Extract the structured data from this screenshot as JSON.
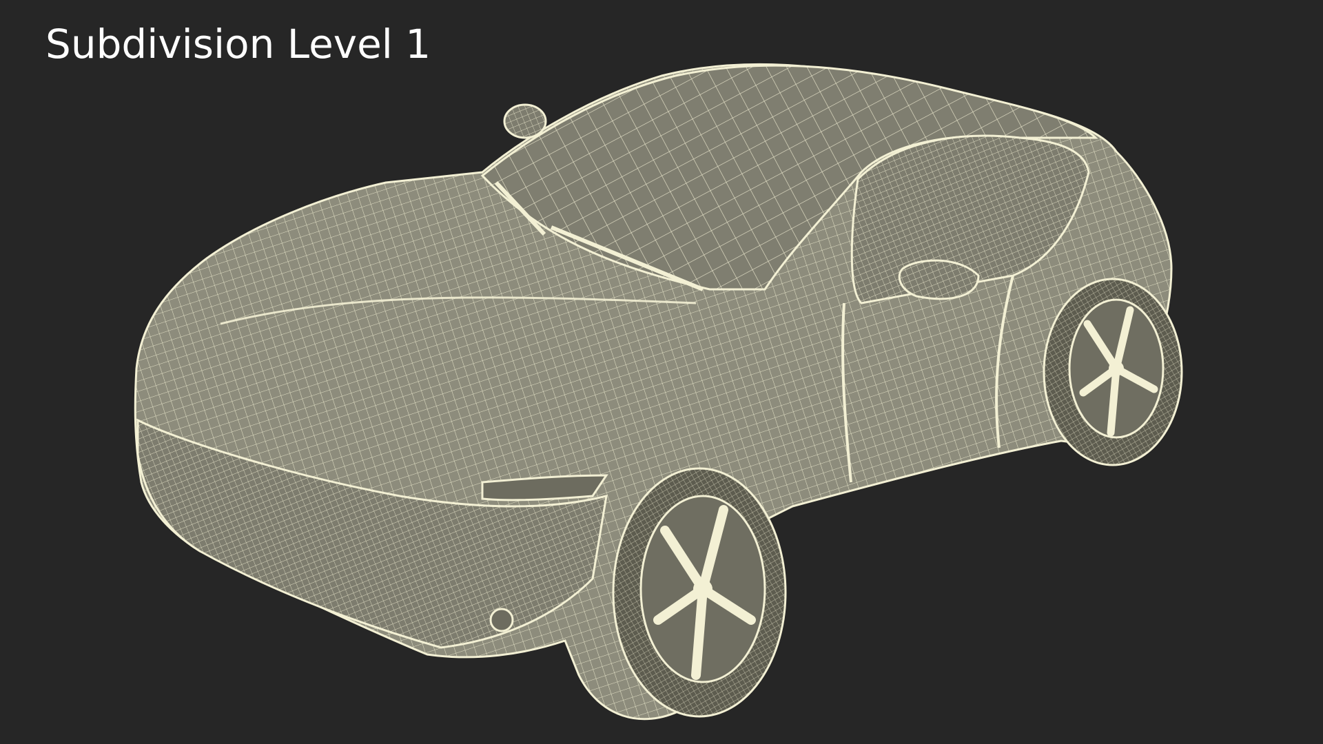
{
  "title": "Subdivision Level 1",
  "colors": {
    "background": "#262626",
    "body_fill": "#8d8c7c",
    "body_fill_dark": "#6e6d60",
    "wire": "#f3f0d4",
    "tire": "#555447"
  },
  "icons": [
    "car-wireframe-render"
  ]
}
